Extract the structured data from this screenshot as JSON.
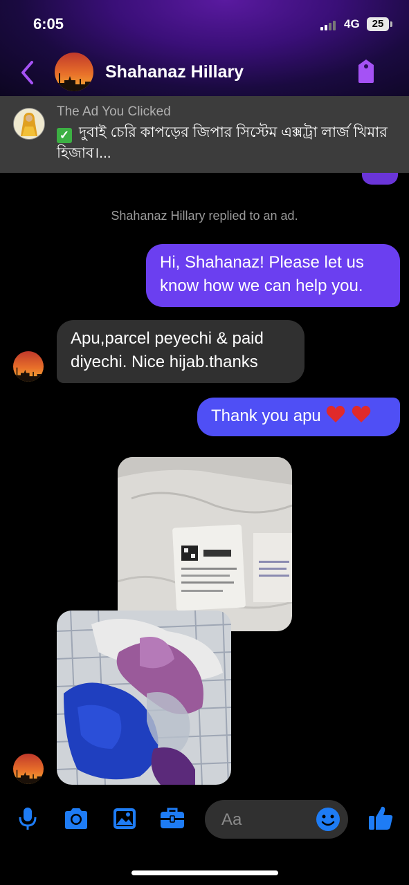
{
  "status": {
    "time": "6:05",
    "network": "4G",
    "battery": "25"
  },
  "header": {
    "name": "Shahanaz Hillary"
  },
  "ad": {
    "label": "The Ad You Clicked",
    "text": "দুবাই চেরি কাপড়ের জিপার সিস্টেম এক্সট্রা লার্জ খিমার হিজাব।..."
  },
  "messages": {
    "system": "Shahanaz Hillary replied to an ad.",
    "out1": "Hi, Shahanaz! Please let us know how we can help you.",
    "in1": "Apu,parcel peyechi & paid diyechi. Nice hijab.thanks",
    "out2": "Thank you apu"
  },
  "composer": {
    "placeholder": "Aa"
  },
  "colors": {
    "accent": "#a552f5",
    "outgoing_bubble": "#6b3ff0",
    "outgoing_bubble_2": "#4f4ff5",
    "incoming_bubble": "#303030",
    "composer_icon": "#1e7cf5"
  },
  "icons": [
    "back-chevron-icon",
    "tag-icon",
    "check-icon",
    "heart-icon",
    "microphone-icon",
    "camera-icon",
    "image-icon",
    "briefcase-icon",
    "emoji-icon",
    "thumbs-up-icon"
  ]
}
